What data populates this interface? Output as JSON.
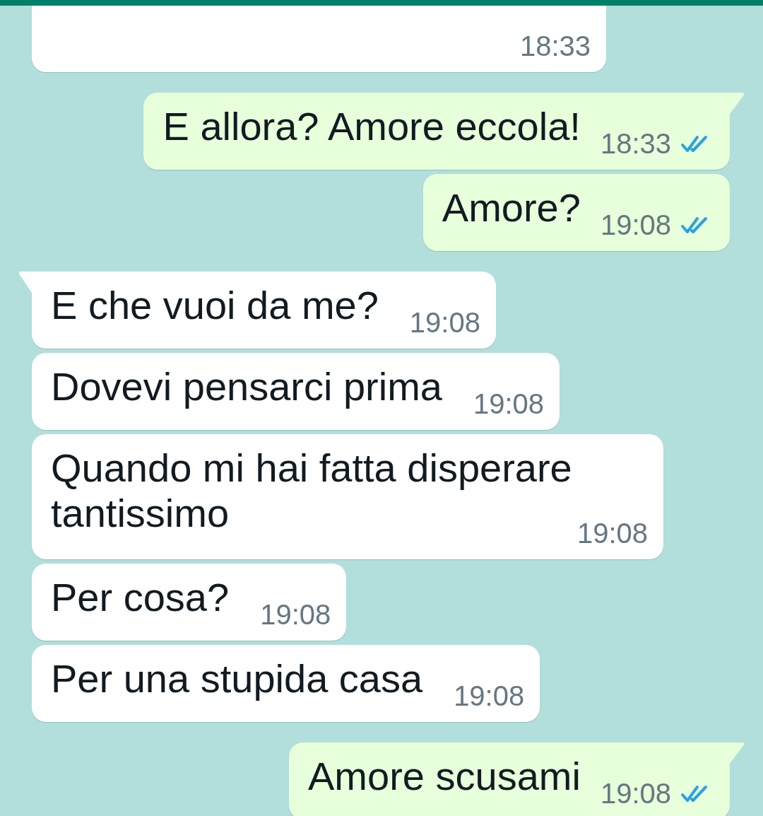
{
  "messages": [
    {
      "kind": "incoming",
      "time": "18:33",
      "tail": false
    },
    {
      "kind": "outgoing",
      "text": "E allora? Amore eccola!",
      "time": "18:33",
      "read": true,
      "tail": true
    },
    {
      "kind": "outgoing",
      "text": "Amore?",
      "time": "19:08",
      "read": true,
      "tail": false
    },
    {
      "kind": "incoming",
      "text": "E che vuoi da me?",
      "time": "19:08",
      "tail": true
    },
    {
      "kind": "incoming",
      "text": "Dovevi pensarci prima",
      "time": "19:08",
      "tail": false
    },
    {
      "kind": "incoming",
      "text": "Quando mi hai fatta disperare tantissimo",
      "time": "19:08",
      "tail": false
    },
    {
      "kind": "incoming",
      "text": "Per cosa?",
      "time": "19:08",
      "tail": false
    },
    {
      "kind": "incoming",
      "text": "Per una stupida casa",
      "time": "19:08",
      "tail": false
    },
    {
      "kind": "outgoing",
      "text": "Amore scusami",
      "time": "19:08",
      "read": true,
      "tail": true
    }
  ]
}
